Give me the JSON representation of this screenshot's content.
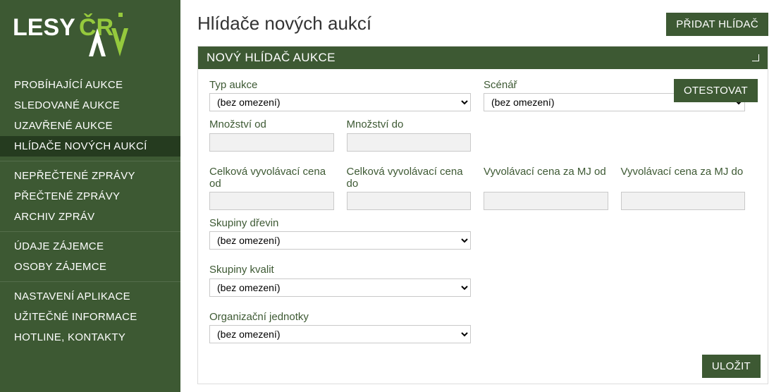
{
  "logo": {
    "text1": "LESY",
    "text2": "ČR"
  },
  "nav": {
    "groups": [
      [
        "PROBÍHAJÍCÍ AUKCE",
        "SLEDOVANÉ AUKCE",
        "UZAVŘENÉ AUKCE",
        "HLÍDAČE NOVÝCH AUKCÍ"
      ],
      [
        "NEPŘEČTENÉ ZPRÁVY",
        "PŘEČTENÉ ZPRÁVY",
        "ARCHIV ZPRÁV"
      ],
      [
        "ÚDAJE ZÁJEMCE",
        "OSOBY ZÁJEMCE"
      ],
      [
        "NASTAVENÍ APLIKACE",
        "UŽITEČNÉ INFORMACE",
        "HOTLINE, KONTAKTY"
      ]
    ],
    "activeLabel": "HLÍDAČE NOVÝCH AUKCÍ"
  },
  "page": {
    "title": "Hlídače nových aukcí",
    "add_button": "PŘIDAT HLÍDAČ"
  },
  "panel": {
    "title": "NOVÝ HLÍDAČ AUKCE",
    "test_button": "OTESTOVAT",
    "save_button": "ULOŽIT",
    "no_limit": "(bez omezení)",
    "fields": {
      "typ_aukce": {
        "label": "Typ aukce"
      },
      "scenar": {
        "label": "Scénář"
      },
      "mnozstvi_od": {
        "label": "Množství od"
      },
      "mnozstvi_do": {
        "label": "Množství do"
      },
      "cvc_od": {
        "label": "Celková vyvolávací cena od"
      },
      "cvc_do": {
        "label": "Celková vyvolávací cena do"
      },
      "vcmj_od": {
        "label": "Vyvolávací cena za MJ od"
      },
      "vcmj_do": {
        "label": "Vyvolávací cena za MJ do"
      },
      "skupiny_drevin": {
        "label": "Skupiny dřevin"
      },
      "skupiny_kvalit": {
        "label": "Skupiny kvalit"
      },
      "organizacni_jednotky": {
        "label": "Organizační jednotky"
      }
    }
  }
}
